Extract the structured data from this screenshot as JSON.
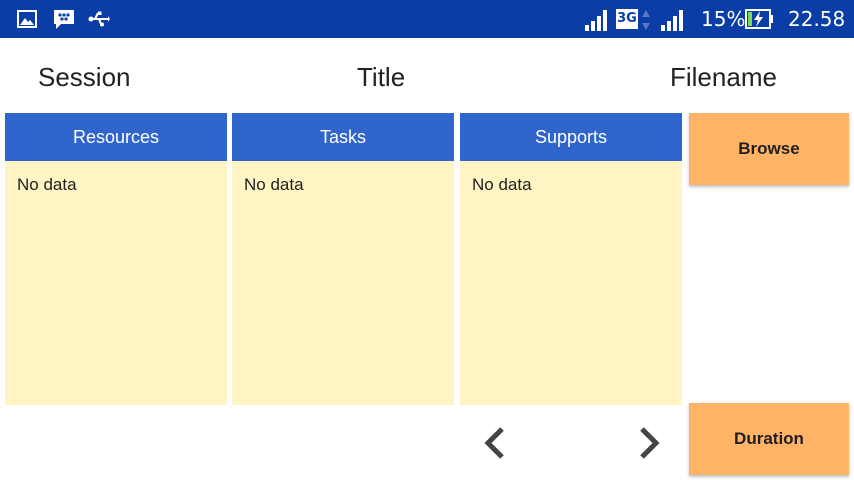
{
  "status_bar": {
    "network_type": "3G",
    "battery_percent": "15%",
    "time": "22.58",
    "icons": [
      "image-icon",
      "bbm-icon",
      "usb-icon",
      "signal-icon",
      "network-3g-icon",
      "signal-icon-2",
      "battery-charging-icon"
    ],
    "background_color": "#0a3ea6"
  },
  "header": {
    "session_label": "Session",
    "title_label": "Title",
    "filename_label": "Filename"
  },
  "columns": [
    {
      "header": "Resources",
      "empty_text": "No data"
    },
    {
      "header": "Tasks",
      "empty_text": "No data"
    },
    {
      "header": "Supports",
      "empty_text": "No data"
    }
  ],
  "buttons": {
    "browse_label": "Browse",
    "duration_label": "Duration"
  },
  "navigation": {
    "prev_icon": "chevron-left-icon",
    "next_icon": "chevron-right-icon"
  },
  "colors": {
    "column_header": "#3066cc",
    "column_body": "#fff4c4",
    "button": "#ffb366"
  }
}
